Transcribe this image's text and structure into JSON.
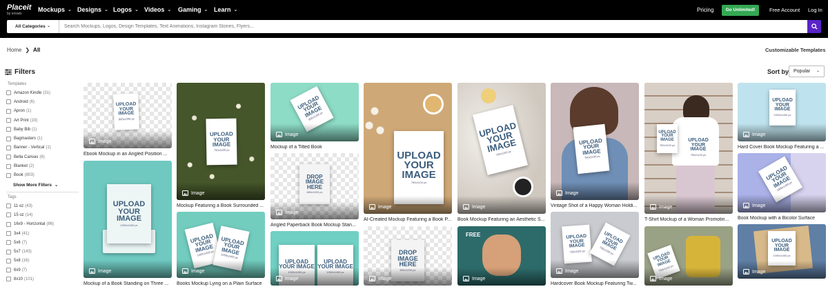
{
  "nav": {
    "logo": "Placeit",
    "logo_sub": "by envato",
    "items": [
      {
        "label": "Mockups"
      },
      {
        "label": "Designs"
      },
      {
        "label": "Logos"
      },
      {
        "label": "Videos"
      },
      {
        "label": "Gaming"
      },
      {
        "label": "Learn"
      }
    ],
    "pricing": "Pricing",
    "go_unlimited": "Go Unlimited!",
    "free_account": "Free Account",
    "login": "Log In"
  },
  "search": {
    "category": "All Categories",
    "placeholder": "Search Mockups, Logos, Design Templates, Text Animations, Instagram Stories, Flyers..."
  },
  "breadcrumb": {
    "home": "Home",
    "separator": "❯",
    "current": "All"
  },
  "customizable": "Customizable Templates",
  "filters": {
    "title": "Filters",
    "templates_title": "Templates",
    "templates": [
      {
        "label": "Amazon Kindle",
        "count": "(31)"
      },
      {
        "label": "Android",
        "count": "(6)"
      },
      {
        "label": "Apron",
        "count": "(1)"
      },
      {
        "label": "Art Print",
        "count": "(19)"
      },
      {
        "label": "Baby Bib",
        "count": "(1)"
      },
      {
        "label": "Bagmasters",
        "count": "(1)"
      },
      {
        "label": "Banner - Vertical",
        "count": "(1)"
      },
      {
        "label": "Bella Canvas",
        "count": "(6)"
      },
      {
        "label": "Blanket",
        "count": "(2)"
      },
      {
        "label": "Book",
        "count": "(803)"
      }
    ],
    "show_more": "Show More Filters",
    "tags_title": "Tags",
    "tags": [
      {
        "label": "11 oz",
        "count": "(43)"
      },
      {
        "label": "15 oz",
        "count": "(14)"
      },
      {
        "label": "16x9 - Horizontal",
        "count": "(86)"
      },
      {
        "label": "3x4",
        "count": "(41)"
      },
      {
        "label": "5x6",
        "count": "(7)"
      },
      {
        "label": "5x7",
        "count": "(143)"
      },
      {
        "label": "5x8",
        "count": "(16)"
      },
      {
        "label": "6x9",
        "count": "(7)"
      },
      {
        "label": "8x10",
        "count": "(101)"
      }
    ]
  },
  "sort": {
    "label": "Sort by",
    "value": "Popular"
  },
  "image_label": "Image",
  "free_label": "FREE",
  "placeholder_text": {
    "upload": "UPLOAD YOUR IMAGE",
    "drop": "DROP IMAGE HERE",
    "s800": "800x1200 px",
    "s750": "750x1100 px",
    "s1000": "1000x1400 px"
  },
  "cards": [
    {
      "caption": "Ebook Mockup in an Angled Position ..."
    },
    {
      "caption": "Mockup of a Book Standing on Three ..."
    },
    {
      "caption": "Mockup Featuring a Book Surrounded ..."
    },
    {
      "caption": "Books Mockup Lying on a Plain Surface"
    },
    {
      "caption": "Mockup of a Tilted Book"
    },
    {
      "caption": "Angled Paperback Book Mockup Stan..."
    },
    {
      "caption": "AI-Created Mockup Featuring a Book P..."
    },
    {
      "caption": "Book Mockup Featuring an Aesthetic S..."
    },
    {
      "caption": "Vintage Shot of a Happy Woman Holdi..."
    },
    {
      "caption": "Hardcover Book Mockup Featuring Tw..."
    },
    {
      "caption": "T-Shirt Mockup of a Woman Promotin..."
    },
    {
      "caption": "Hard Cover Book Mockup Featuring a ..."
    },
    {
      "caption": "Book Mockup with a Bicolor Surface"
    }
  ]
}
